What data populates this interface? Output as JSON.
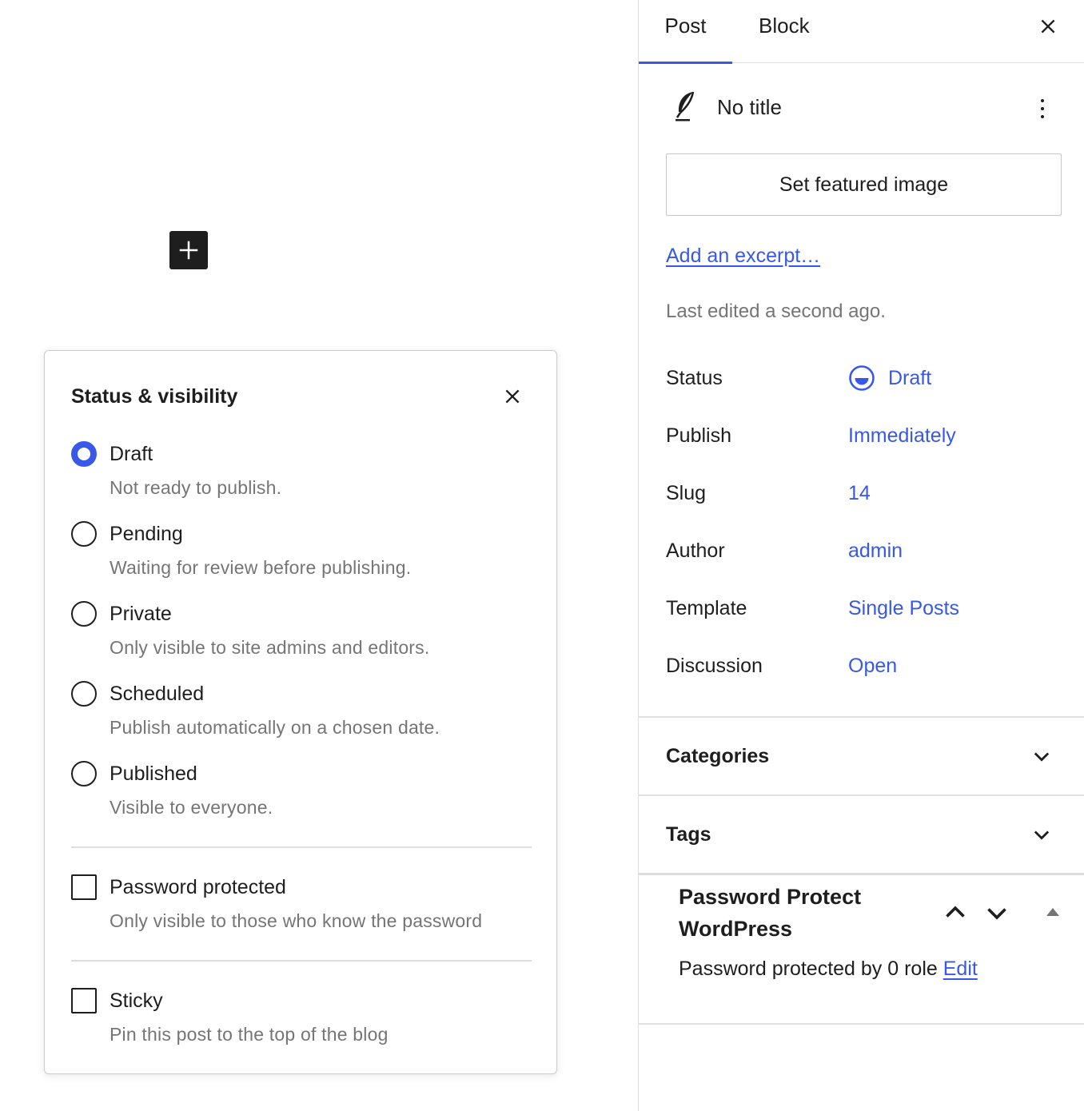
{
  "colors": {
    "accent": "#3858e9",
    "text": "#1e1e1e",
    "muted": "#757575",
    "border": "#e0e0e0"
  },
  "editor": {
    "inserter_icon": "plus-icon"
  },
  "popover": {
    "title": "Status & visibility",
    "close_icon": "close-icon",
    "options": [
      {
        "label": "Draft",
        "help": "Not ready to publish.",
        "checked": true
      },
      {
        "label": "Pending",
        "help": "Waiting for review before publishing.",
        "checked": false
      },
      {
        "label": "Private",
        "help": "Only visible to site admins and editors.",
        "checked": false
      },
      {
        "label": "Scheduled",
        "help": "Publish automatically on a chosen date.",
        "checked": false
      },
      {
        "label": "Published",
        "help": "Visible to everyone.",
        "checked": false
      }
    ],
    "password": {
      "label": "Password protected",
      "help": "Only visible to those who know the password",
      "checked": false
    },
    "sticky": {
      "label": "Sticky",
      "help": "Pin this post to the top of the blog",
      "checked": false
    }
  },
  "sidebar": {
    "tabs": [
      {
        "label": "Post",
        "active": true
      },
      {
        "label": "Block",
        "active": false
      }
    ],
    "post": {
      "icon": "quill-icon",
      "title": "No title",
      "featured_button": "Set featured image",
      "excerpt_link": "Add an excerpt…",
      "last_edited": "Last edited a second ago."
    },
    "meta": [
      {
        "label": "Status",
        "value": "Draft"
      },
      {
        "label": "Publish",
        "value": "Immediately"
      },
      {
        "label": "Slug",
        "value": "14"
      },
      {
        "label": "Author",
        "value": "admin"
      },
      {
        "label": "Template",
        "value": "Single Posts"
      },
      {
        "label": "Discussion",
        "value": "Open"
      }
    ],
    "panels": [
      {
        "title": "Categories"
      },
      {
        "title": "Tags"
      }
    ],
    "plugin": {
      "title": "Password Protect WordPress",
      "text": "Password protected by 0 role",
      "edit": "Edit"
    }
  }
}
